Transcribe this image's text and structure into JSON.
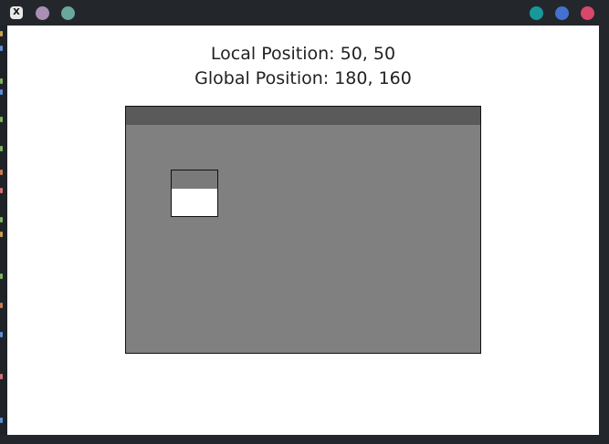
{
  "window": {
    "app_icon_glyph": "X",
    "left_controls": [
      {
        "name": "lavender-dot",
        "color": "#a88fb3"
      },
      {
        "name": "teal-dot",
        "color": "#6aa79c"
      }
    ],
    "right_controls": [
      {
        "name": "minimize-button",
        "color": "#17999a"
      },
      {
        "name": "maximize-button",
        "color": "#4371d0"
      },
      {
        "name": "close-button",
        "color": "#d9476a"
      }
    ]
  },
  "content": {
    "local_position_text": "Local Position: 50, 50",
    "global_position_text": "Global Position: 180, 160"
  }
}
